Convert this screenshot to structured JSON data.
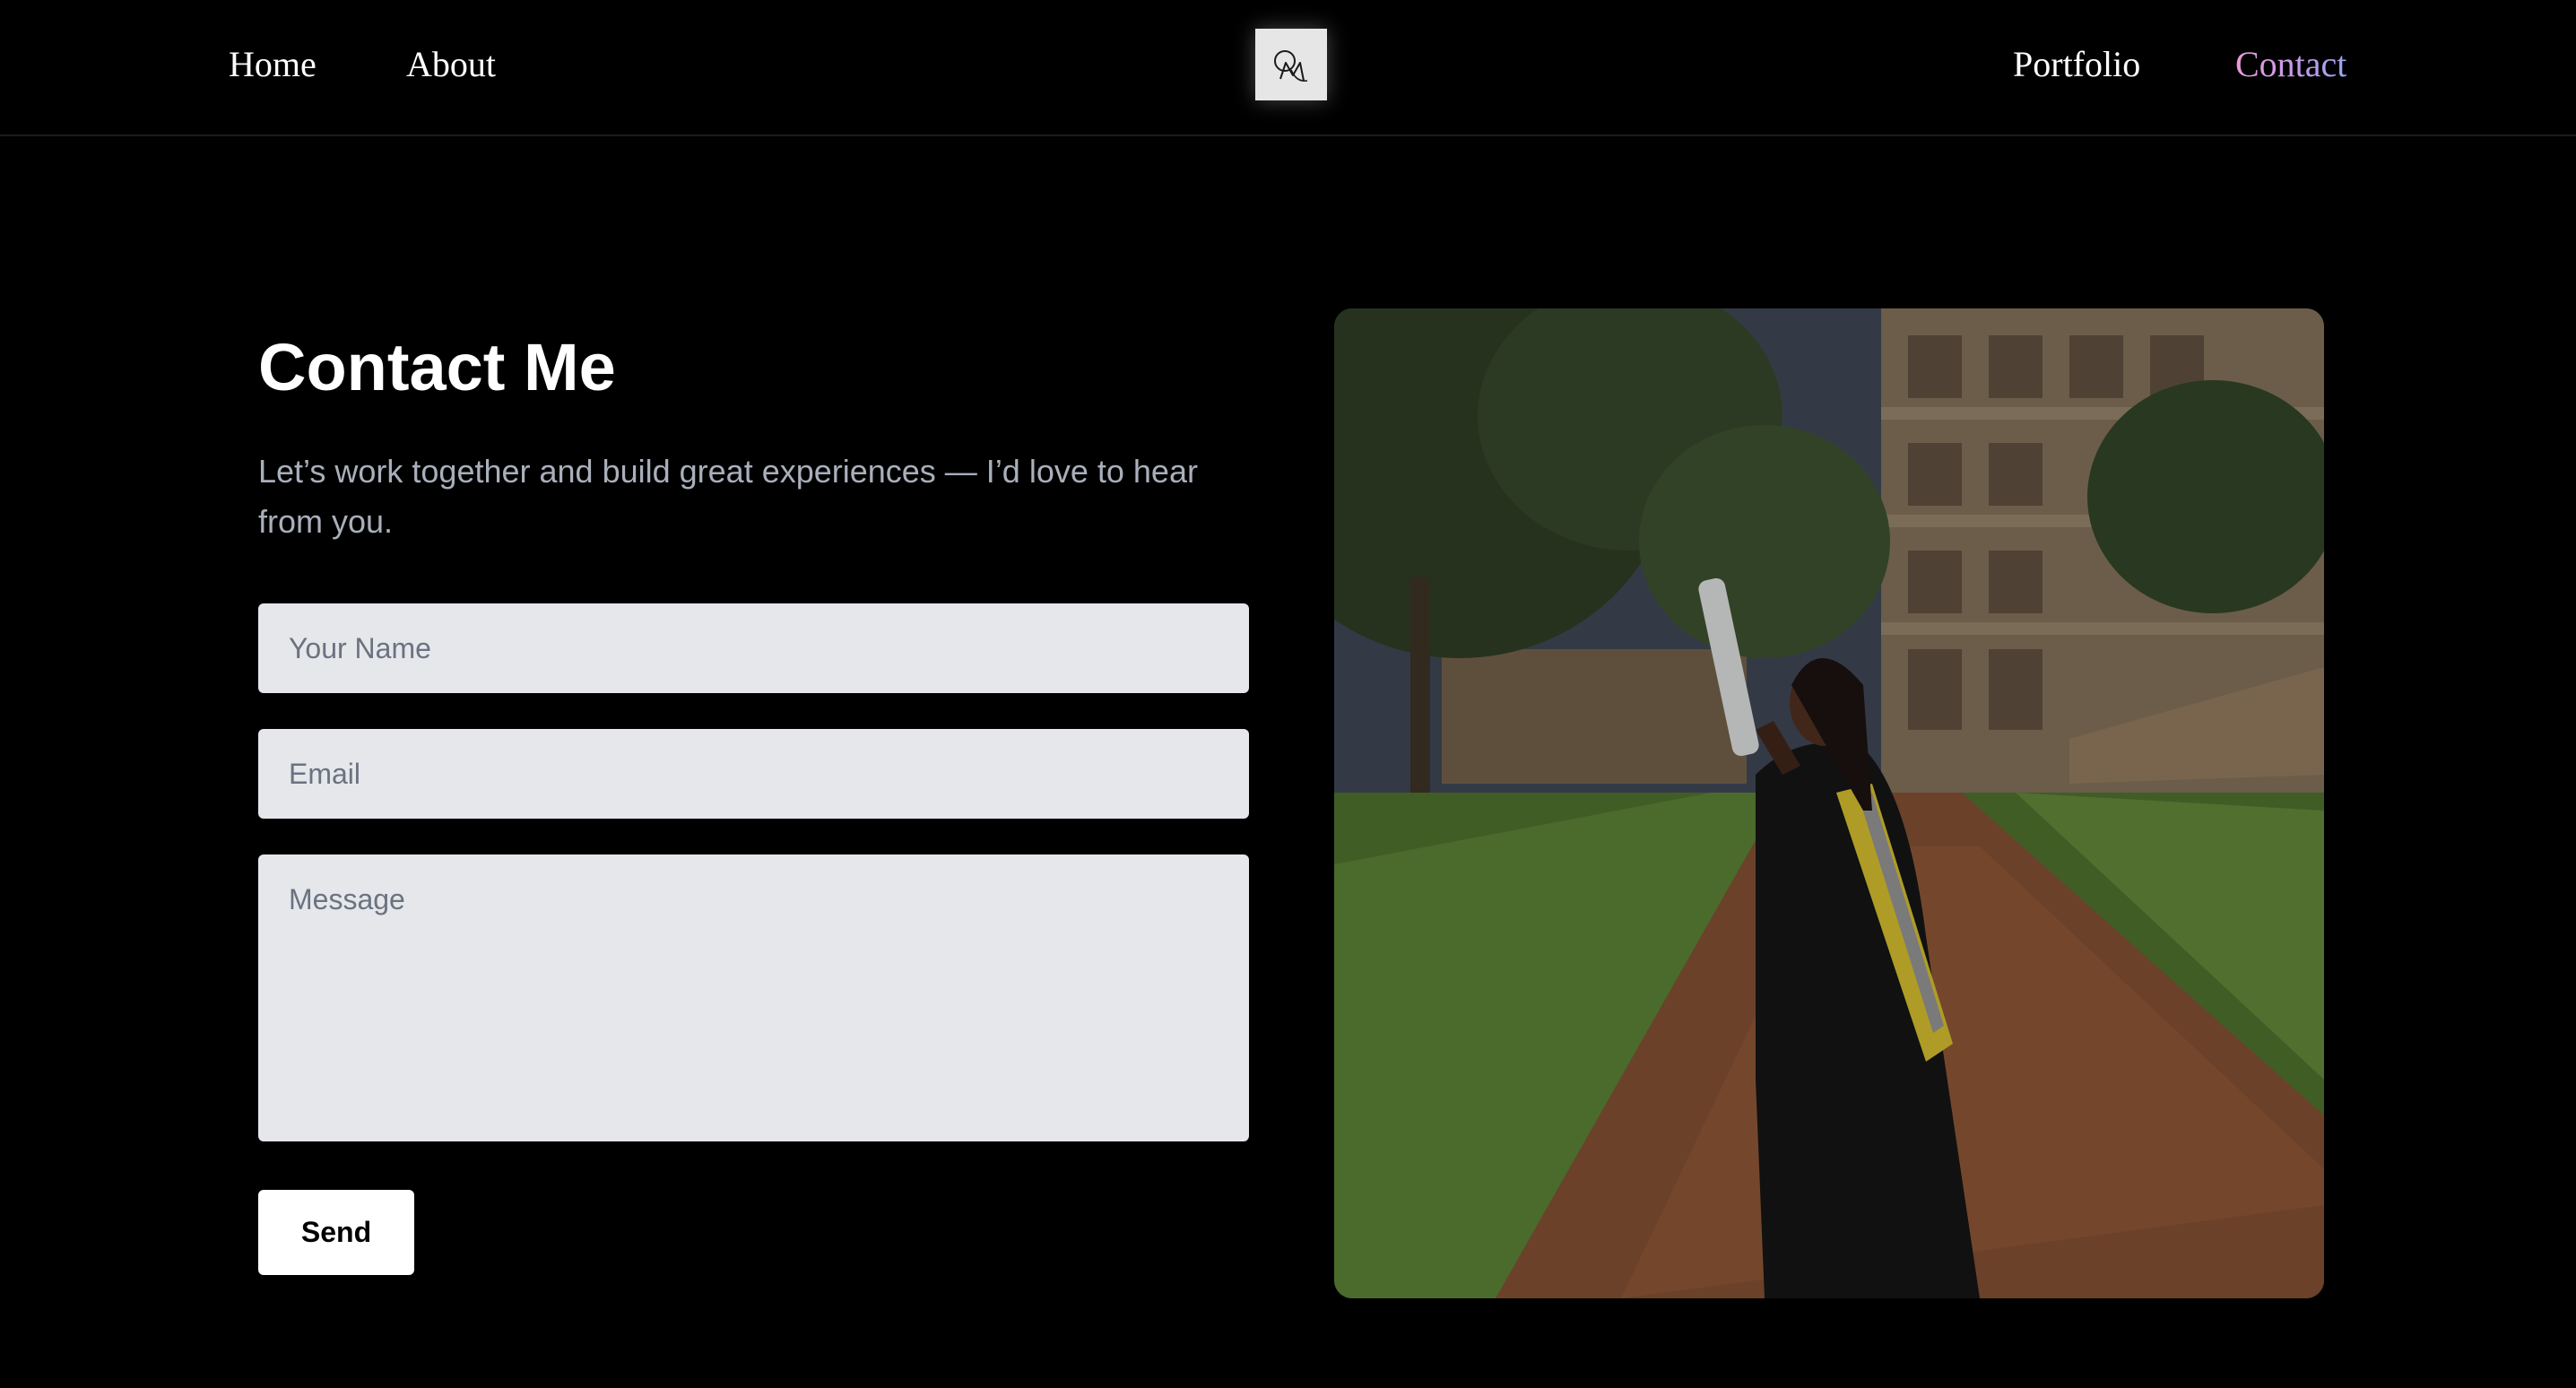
{
  "nav": {
    "left_links": [
      "Home",
      "About"
    ],
    "right_links": [
      "Portfolio",
      "Contact"
    ],
    "active": "Contact",
    "logo_icon": "monogram-logo-icon"
  },
  "contact": {
    "title": "Contact Me",
    "subtitle": "Let’s work together and build great experiences — I’d love to hear from you.",
    "name_placeholder": "Your Name",
    "email_placeholder": "Email",
    "message_placeholder": "Message",
    "name_value": "",
    "email_value": "",
    "message_value": "",
    "send_label": "Send"
  },
  "colors": {
    "background": "#000000",
    "input_bg": "#e5e7eb",
    "placeholder": "#6b7280",
    "subtitle": "#a9afbb",
    "accent_gradient": [
      "#e89ad8",
      "#c79ae6",
      "#9aa6f0"
    ]
  }
}
